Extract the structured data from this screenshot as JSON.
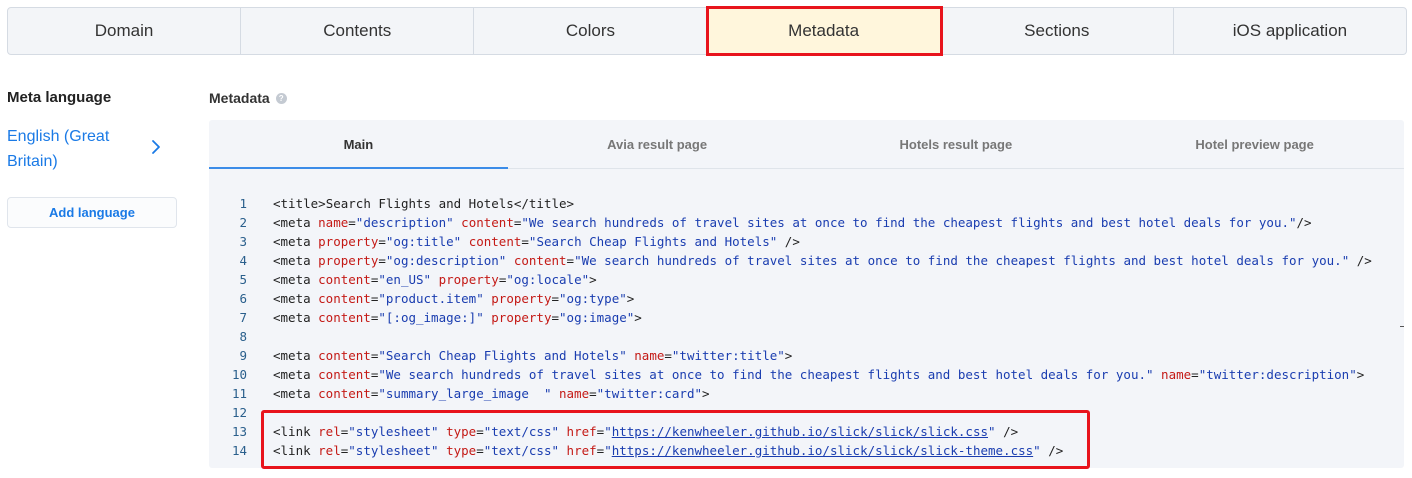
{
  "top_tabs": [
    {
      "label": "Domain",
      "active": false
    },
    {
      "label": "Contents",
      "active": false
    },
    {
      "label": "Colors",
      "active": false
    },
    {
      "label": "Metadata",
      "active": true
    },
    {
      "label": "Sections",
      "active": false
    },
    {
      "label": "iOS application",
      "active": false
    }
  ],
  "sidebar": {
    "title": "Meta language",
    "language": "English (Great Britain)",
    "add_language_label": "Add language"
  },
  "metadata": {
    "title": "Metadata",
    "help_icon": "?",
    "sub_tabs": [
      {
        "label": "Main",
        "active": true
      },
      {
        "label": "Avia result page",
        "active": false
      },
      {
        "label": "Hotels result page",
        "active": false
      },
      {
        "label": "Hotel preview page",
        "active": false
      }
    ],
    "code_lines": [
      {
        "n": "1"
      },
      {
        "n": "2"
      },
      {
        "n": "3"
      },
      {
        "n": "4"
      },
      {
        "n": "5"
      },
      {
        "n": "6"
      },
      {
        "n": "7"
      },
      {
        "n": "8"
      },
      {
        "n": "9"
      },
      {
        "n": "10"
      },
      {
        "n": "11"
      },
      {
        "n": "12"
      },
      {
        "n": "13"
      },
      {
        "n": "14"
      }
    ],
    "code": {
      "l1": {
        "open": "<title>",
        "text": "Search Flights and Hotels",
        "close": "</title>"
      },
      "l2": {
        "a1": "name",
        "v1": "\"description\"",
        "a2": "content",
        "v2": "\"We search hundreds of travel sites at once to find the cheapest flights and best hotel deals for you.\"",
        "end": "/>"
      },
      "l3": {
        "a1": "property",
        "v1": "\"og:title\"",
        "a2": "content",
        "v2": "\"Search Cheap Flights and Hotels\"",
        "end": " />"
      },
      "l4": {
        "a1": "property",
        "v1": "\"og:description\"",
        "a2": "content",
        "v2": "\"We search hundreds of travel sites at once to find the cheapest flights and best hotel deals for you.\"",
        "end": " />"
      },
      "l5": {
        "a1": "content",
        "v1": "\"en_US\"",
        "a2": "property",
        "v2": "\"og:locale\"",
        "end": ">"
      },
      "l6": {
        "a1": "content",
        "v1": "\"product.item\"",
        "a2": "property",
        "v2": "\"og:type\"",
        "end": ">"
      },
      "l7": {
        "a1": "content",
        "v1": "\"[:og_image:]\"",
        "a2": "property",
        "v2": "\"og:image\"",
        "end": ">"
      },
      "l9": {
        "a1": "content",
        "v1": "\"Search Cheap Flights and Hotels\"",
        "a2": "name",
        "v2": "\"twitter:title\"",
        "end": ">"
      },
      "l10": {
        "a1": "content",
        "v1": "\"We search hundreds of travel sites at once to find the cheapest flights and best hotel deals for you.\"",
        "a2": "name",
        "v2": "\"twitter:description\"",
        "end": ">"
      },
      "l11": {
        "a1": "content",
        "v1": "\"summary_large_image  \"",
        "a2": "name",
        "v2": "\"twitter:card\"",
        "end": ">"
      },
      "l13": {
        "a1": "rel",
        "v1": "\"stylesheet\"",
        "a2": "type",
        "v2": "\"text/css\"",
        "a3": "href",
        "url": "https://kenwheeler.github.io/slick/slick/slick.css",
        "end": " />"
      },
      "l14": {
        "a1": "rel",
        "v1": "\"stylesheet\"",
        "a2": "type",
        "v2": "\"text/css\"",
        "a3": "href",
        "url": "https://kenwheeler.github.io/slick/slick/slick-theme.css",
        "end": " />"
      }
    }
  },
  "colors": {
    "accent_blue": "#1a7ae6",
    "highlight_red": "#e8141c",
    "active_tab_bg": "#fff6dc"
  }
}
